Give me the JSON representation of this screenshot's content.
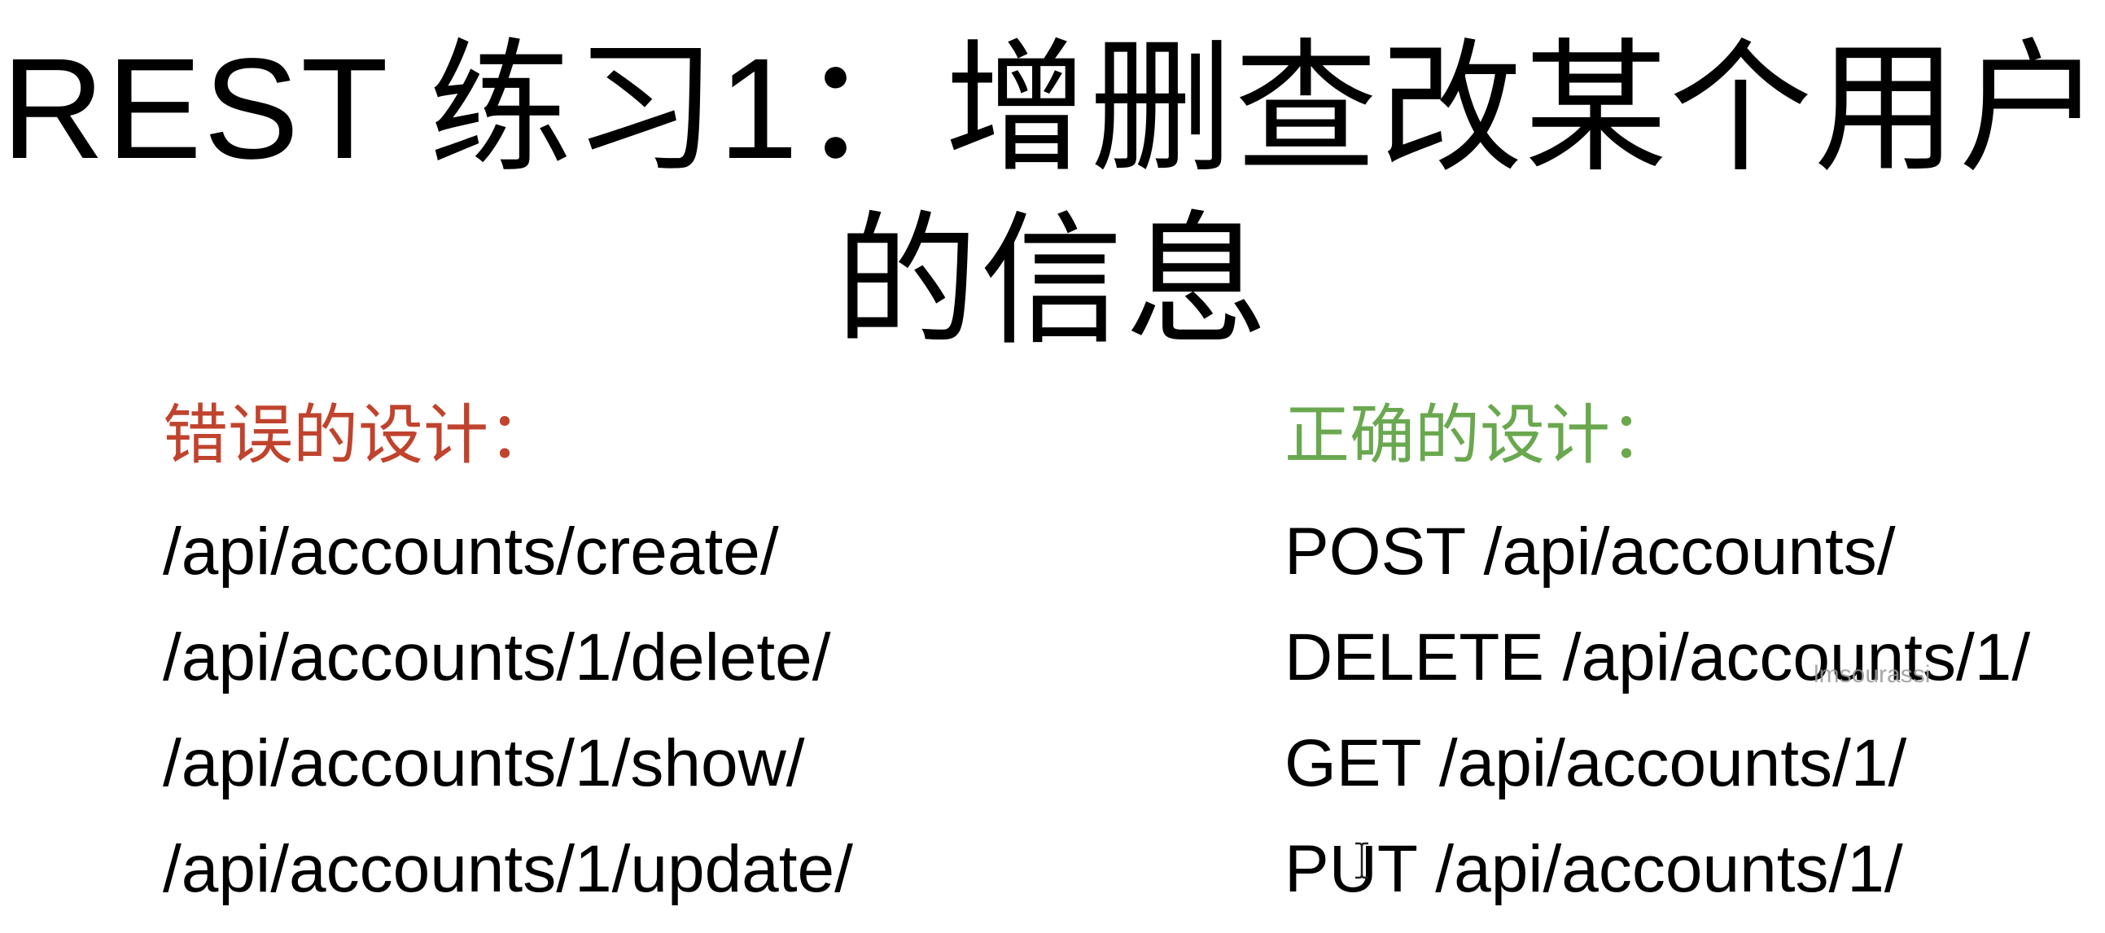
{
  "slide": {
    "title_line1": "REST 练习1：增删查改某个用户",
    "title_line2": "的信息",
    "wrong": {
      "heading": "错误的设计：",
      "color": "#c0432d",
      "items": [
        "/api/accounts/create/",
        "/api/accounts/1/delete/",
        "/api/accounts/1/show/",
        "/api/accounts/1/update/"
      ]
    },
    "right": {
      "heading": "正确的设计：",
      "color": "#6aa84f",
      "items": [
        "POST /api/accounts/",
        "DELETE /api/accounts/1/",
        "GET /api/accounts/1/",
        "PUT /api/accounts/1/"
      ]
    },
    "watermark": "lmsourassi"
  }
}
